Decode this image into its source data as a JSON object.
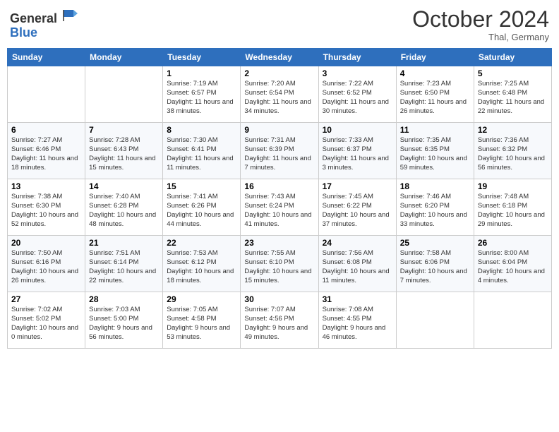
{
  "header": {
    "logo_general": "General",
    "logo_blue": "Blue",
    "month_title": "October 2024",
    "subtitle": "Thal, Germany"
  },
  "weekdays": [
    "Sunday",
    "Monday",
    "Tuesday",
    "Wednesday",
    "Thursday",
    "Friday",
    "Saturday"
  ],
  "weeks": [
    [
      {
        "day": "",
        "info": ""
      },
      {
        "day": "",
        "info": ""
      },
      {
        "day": "1",
        "info": "Sunrise: 7:19 AM\nSunset: 6:57 PM\nDaylight: 11 hours and 38 minutes."
      },
      {
        "day": "2",
        "info": "Sunrise: 7:20 AM\nSunset: 6:54 PM\nDaylight: 11 hours and 34 minutes."
      },
      {
        "day": "3",
        "info": "Sunrise: 7:22 AM\nSunset: 6:52 PM\nDaylight: 11 hours and 30 minutes."
      },
      {
        "day": "4",
        "info": "Sunrise: 7:23 AM\nSunset: 6:50 PM\nDaylight: 11 hours and 26 minutes."
      },
      {
        "day": "5",
        "info": "Sunrise: 7:25 AM\nSunset: 6:48 PM\nDaylight: 11 hours and 22 minutes."
      }
    ],
    [
      {
        "day": "6",
        "info": "Sunrise: 7:27 AM\nSunset: 6:46 PM\nDaylight: 11 hours and 18 minutes."
      },
      {
        "day": "7",
        "info": "Sunrise: 7:28 AM\nSunset: 6:43 PM\nDaylight: 11 hours and 15 minutes."
      },
      {
        "day": "8",
        "info": "Sunrise: 7:30 AM\nSunset: 6:41 PM\nDaylight: 11 hours and 11 minutes."
      },
      {
        "day": "9",
        "info": "Sunrise: 7:31 AM\nSunset: 6:39 PM\nDaylight: 11 hours and 7 minutes."
      },
      {
        "day": "10",
        "info": "Sunrise: 7:33 AM\nSunset: 6:37 PM\nDaylight: 11 hours and 3 minutes."
      },
      {
        "day": "11",
        "info": "Sunrise: 7:35 AM\nSunset: 6:35 PM\nDaylight: 10 hours and 59 minutes."
      },
      {
        "day": "12",
        "info": "Sunrise: 7:36 AM\nSunset: 6:32 PM\nDaylight: 10 hours and 56 minutes."
      }
    ],
    [
      {
        "day": "13",
        "info": "Sunrise: 7:38 AM\nSunset: 6:30 PM\nDaylight: 10 hours and 52 minutes."
      },
      {
        "day": "14",
        "info": "Sunrise: 7:40 AM\nSunset: 6:28 PM\nDaylight: 10 hours and 48 minutes."
      },
      {
        "day": "15",
        "info": "Sunrise: 7:41 AM\nSunset: 6:26 PM\nDaylight: 10 hours and 44 minutes."
      },
      {
        "day": "16",
        "info": "Sunrise: 7:43 AM\nSunset: 6:24 PM\nDaylight: 10 hours and 41 minutes."
      },
      {
        "day": "17",
        "info": "Sunrise: 7:45 AM\nSunset: 6:22 PM\nDaylight: 10 hours and 37 minutes."
      },
      {
        "day": "18",
        "info": "Sunrise: 7:46 AM\nSunset: 6:20 PM\nDaylight: 10 hours and 33 minutes."
      },
      {
        "day": "19",
        "info": "Sunrise: 7:48 AM\nSunset: 6:18 PM\nDaylight: 10 hours and 29 minutes."
      }
    ],
    [
      {
        "day": "20",
        "info": "Sunrise: 7:50 AM\nSunset: 6:16 PM\nDaylight: 10 hours and 26 minutes."
      },
      {
        "day": "21",
        "info": "Sunrise: 7:51 AM\nSunset: 6:14 PM\nDaylight: 10 hours and 22 minutes."
      },
      {
        "day": "22",
        "info": "Sunrise: 7:53 AM\nSunset: 6:12 PM\nDaylight: 10 hours and 18 minutes."
      },
      {
        "day": "23",
        "info": "Sunrise: 7:55 AM\nSunset: 6:10 PM\nDaylight: 10 hours and 15 minutes."
      },
      {
        "day": "24",
        "info": "Sunrise: 7:56 AM\nSunset: 6:08 PM\nDaylight: 10 hours and 11 minutes."
      },
      {
        "day": "25",
        "info": "Sunrise: 7:58 AM\nSunset: 6:06 PM\nDaylight: 10 hours and 7 minutes."
      },
      {
        "day": "26",
        "info": "Sunrise: 8:00 AM\nSunset: 6:04 PM\nDaylight: 10 hours and 4 minutes."
      }
    ],
    [
      {
        "day": "27",
        "info": "Sunrise: 7:02 AM\nSunset: 5:02 PM\nDaylight: 10 hours and 0 minutes."
      },
      {
        "day": "28",
        "info": "Sunrise: 7:03 AM\nSunset: 5:00 PM\nDaylight: 9 hours and 56 minutes."
      },
      {
        "day": "29",
        "info": "Sunrise: 7:05 AM\nSunset: 4:58 PM\nDaylight: 9 hours and 53 minutes."
      },
      {
        "day": "30",
        "info": "Sunrise: 7:07 AM\nSunset: 4:56 PM\nDaylight: 9 hours and 49 minutes."
      },
      {
        "day": "31",
        "info": "Sunrise: 7:08 AM\nSunset: 4:55 PM\nDaylight: 9 hours and 46 minutes."
      },
      {
        "day": "",
        "info": ""
      },
      {
        "day": "",
        "info": ""
      }
    ]
  ]
}
